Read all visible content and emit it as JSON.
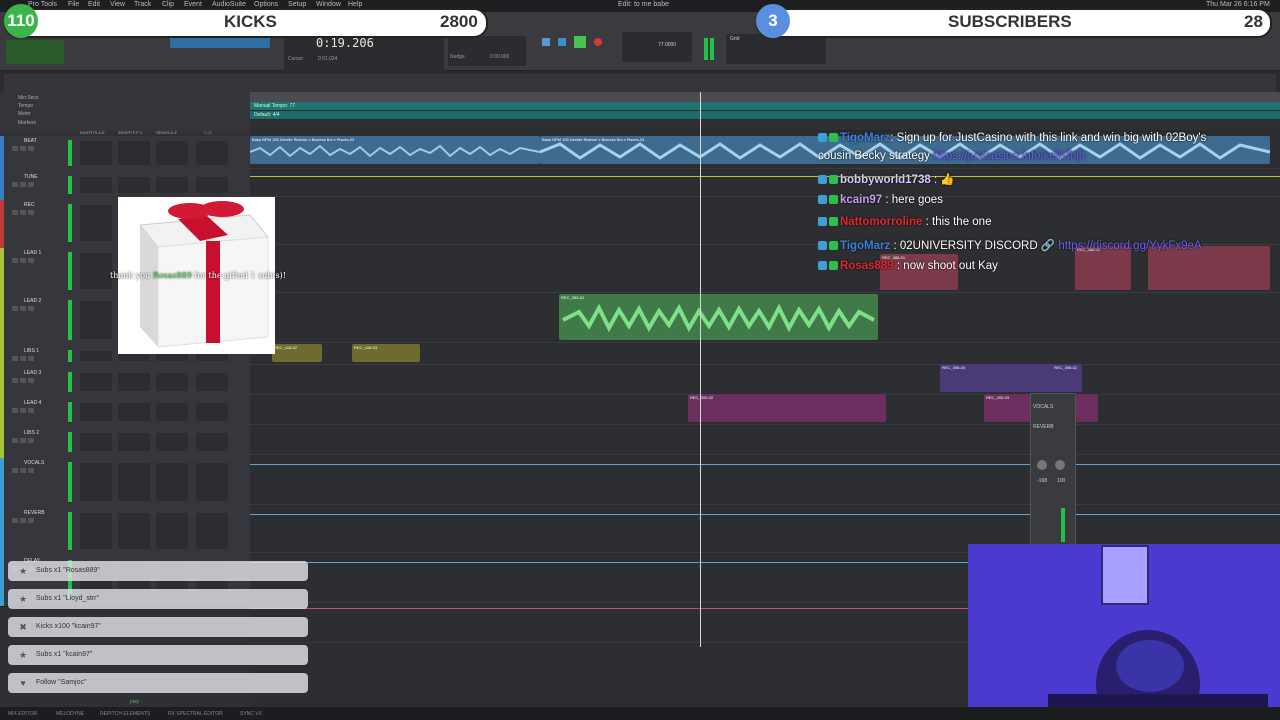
{
  "menubar": {
    "items": [
      "Pro Tools",
      "File",
      "Edit",
      "View",
      "Track",
      "Clip",
      "Event",
      "AudioSuite",
      "Options",
      "Setup",
      "Window",
      "Help"
    ],
    "session_title": "Edit: to me babe",
    "clock": "Thu Mar 26  6:16 PM"
  },
  "transport": {
    "main_counter": "0:19.206",
    "cursor_label": "Cursor",
    "cursor_value": "0:01.024",
    "nudge_label": "Nudge",
    "grid_label": "Grid",
    "grid_value": "0:00.000",
    "tempo_value": "77.0000"
  },
  "rulers": {
    "labels": [
      "Min:Secs",
      "Tempo",
      "Meter",
      "Markers"
    ],
    "tempo_text": "Manual Tempo: 77",
    "meter_text": "Default: 4/4"
  },
  "stream_overlay": {
    "kicks": {
      "count": "110",
      "label": "KICKS",
      "value": "2800"
    },
    "subscribers": {
      "count": "3",
      "label": "SUBSCRIBERS",
      "value": "28"
    },
    "colors": {
      "kicks_circle": "#39b54a",
      "subs_circle": "#5a8fe0"
    }
  },
  "tracks": [
    {
      "name": "BEAT",
      "color": "#3b7cc4"
    },
    {
      "name": "TUNE",
      "color": "#3b7cc4"
    },
    {
      "name": "REC",
      "color": "#c03838"
    },
    {
      "name": "LEAD 1",
      "color": "#a8c43c"
    },
    {
      "name": "LEAD 2",
      "color": "#a8c43c"
    },
    {
      "name": "LIBS 1",
      "color": "#a8c43c"
    },
    {
      "name": "LEAD 3",
      "color": "#a8c43c"
    },
    {
      "name": "LEAD 4",
      "color": "#a8c43c"
    },
    {
      "name": "LIBS 2",
      "color": "#a8c43c"
    },
    {
      "name": "VOCALS",
      "color": "#3b9fcf"
    },
    {
      "name": "REVERB",
      "color": "#3b9fcf"
    },
    {
      "name": "DELAY",
      "color": "#3b9fcf"
    }
  ],
  "column_headers": [
    "INSERTS A-E",
    "INSERTS F-J",
    "SENDS A-E",
    "I / O"
  ],
  "clips": {
    "beat_a": "Baby BPM 155 Derelle Rideout x Bizness Boi x Pisces-03",
    "beat_b": "Baby BPM 155 Derelle Rideout x Bizness Boi x Pisces-03",
    "lead2": "REC_383-02",
    "libs1_a": "REC_418-02",
    "libs1_b": "REC_418-03",
    "lead3_a": "REC_396-03",
    "lead3_b": "REC_396-02",
    "lead4_a": "REC_400-02",
    "lead4_b": "REC_400-03",
    "lead1_a": "REC_386-01",
    "lead1_b": "REC_386-02"
  },
  "gift": {
    "message_pre": "thank you ",
    "user": "Rosas889",
    "message_post": " for the gifted 1 sub(s)!"
  },
  "chat": [
    {
      "user": "TigoMarz",
      "text": ": Sign up for JustCasino with this link and win big with 02Boy's",
      "user_color": "#3f7fd8"
    },
    {
      "user": "",
      "text": "cousin Becky strategy ",
      "link": "https://justcasino.info/kelisfhjh",
      "user_color": "#ffffff"
    },
    {
      "user": "bobbyworld1738",
      "text": " : 👍",
      "user_color": "#d6c9ff"
    },
    {
      "user": "kcain97",
      "text": " : here goes",
      "user_color": "#c79bf2"
    },
    {
      "user": "Nattomorroline",
      "text": " : this the one",
      "user_color": "#e0262e"
    },
    {
      "user": "TigoMarz",
      "text": " : 02UNIVERSITY DISCORD 🔗 ",
      "link": "https://discord.gg/YykFx9eA",
      "user_color": "#3f7fd8"
    },
    {
      "user": "Rosas889",
      "text": " : now shoot out Kay",
      "user_color": "#e0262e"
    }
  ],
  "events": [
    {
      "icon": "star-icon",
      "text": "Subs x1 \"Rosas889\""
    },
    {
      "icon": "star-icon",
      "text": "Subs x1 \"Lloyd_strr\""
    },
    {
      "icon": "kick-icon",
      "text": "Kicks x100 \"kcain97\""
    },
    {
      "icon": "star-icon",
      "text": "Subs x1 \"kcain97\""
    },
    {
      "icon": "heart-icon",
      "text": "Follow \"Samjoc\""
    }
  ],
  "mini_mixer": {
    "track": "VOCALS",
    "insert": "REVERB",
    "volume": "-168",
    "pan": "100"
  },
  "bottom_bar": {
    "items": [
      "MIX EDITOR",
      "MELODYNE",
      "REPITCH ELEMENTS",
      "RX SPECTRAL EDITOR",
      "SYNC VX"
    ],
    "play_label": "play"
  }
}
